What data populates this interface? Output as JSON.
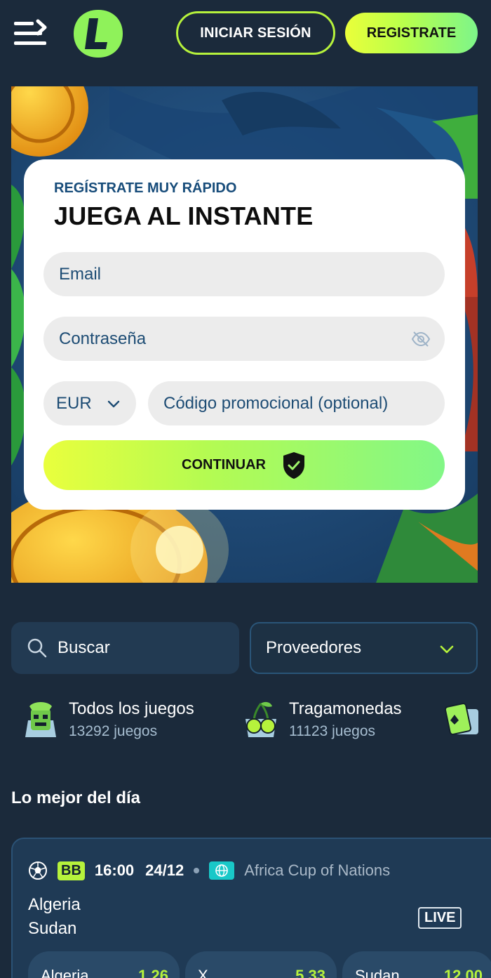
{
  "header": {
    "login_label": "INICIAR SESIÓN",
    "register_label": "REGISTRATE",
    "logo_letter": "L"
  },
  "signup": {
    "subtitle": "REGÍSTRATE MUY RÁPIDO",
    "title": "JUEGA AL INSTANTE",
    "email_placeholder": "Email",
    "password_placeholder": "Contraseña",
    "currency": "EUR",
    "promo_placeholder": "Código promocional (optional)",
    "continue_label": "CONTINUAR"
  },
  "filters": {
    "search_placeholder": "Buscar",
    "providers_label": "Proveedores"
  },
  "categories": [
    {
      "name": "Todos los juegos",
      "count": "13292 juegos",
      "icon": "totem-icon"
    },
    {
      "name": "Tragamonedas",
      "count": "11123 juegos",
      "icon": "cherries-icon"
    },
    {
      "name": "",
      "count": "",
      "icon": "cards-icon"
    }
  ],
  "best_of_day": {
    "title": "Lo mejor del día",
    "match": {
      "badge": "BB",
      "time": "16:00",
      "date": "24/12",
      "league": "Africa Cup of Nations",
      "home": "Algeria",
      "away": "Sudan",
      "live_label": "LIVE",
      "odds": [
        {
          "label": "Algeria",
          "value": "1.26"
        },
        {
          "label": "X",
          "value": "5.33"
        },
        {
          "label": "Sudan",
          "value": "12.00"
        }
      ]
    }
  },
  "colors": {
    "background": "#1b2a3b",
    "accent": "#b6f23c",
    "card": "#ffffff"
  }
}
